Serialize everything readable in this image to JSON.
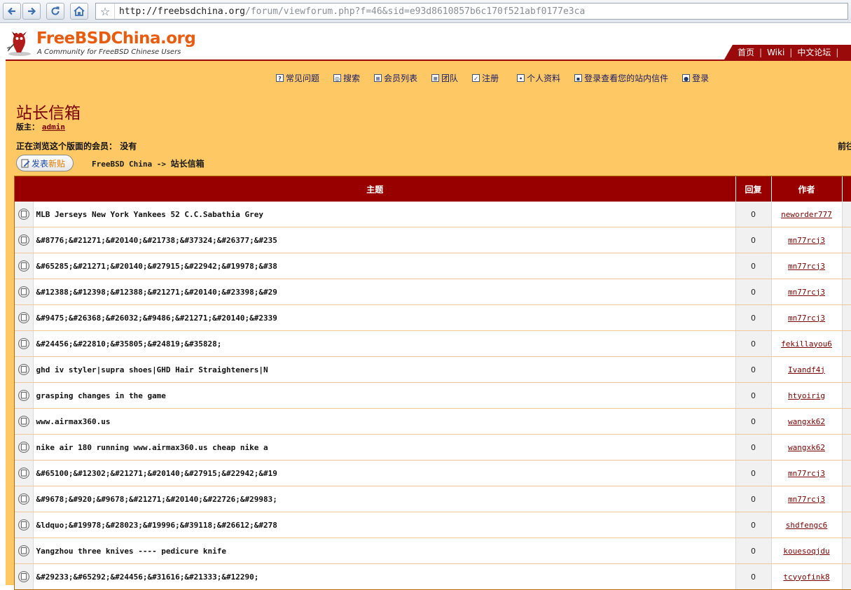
{
  "browser": {
    "url_host": "http://freebsdchina.org",
    "url_path": "/forum/viewforum.php?f=46&sid=e93d8610857b6c170f521abf0177e3ca"
  },
  "site": {
    "logo_title": "FreeBSDChina.org",
    "logo_subtitle": "A Community for FreeBSD Chinese Users",
    "top_links": [
      "首页",
      "Wiki",
      "中文论坛"
    ]
  },
  "menu": [
    {
      "icon": "faq-icon",
      "label": "常见问题"
    },
    {
      "icon": "search-icon",
      "label": "搜索"
    },
    {
      "icon": "memberlist-icon",
      "label": "会员列表"
    },
    {
      "icon": "group-icon",
      "label": "团队"
    },
    {
      "icon": "register-icon",
      "label": "注册"
    },
    {
      "icon": "profile-icon",
      "label": "个人资料"
    },
    {
      "icon": "messages-icon",
      "label": "登录查看您的站内信件"
    },
    {
      "icon": "login-icon",
      "label": "登录"
    }
  ],
  "forum": {
    "title": "站长信箱",
    "moderator_label": "版主：",
    "moderator_name": "admin",
    "viewing_label": "正在浏览这个版面的会员：",
    "viewing_value": "没有",
    "right_edge_text": "前往",
    "post_button_a": "发表",
    "post_button_b": "新贴",
    "breadcrumb_home": "FreeBSD China",
    "breadcrumb_arrow": "->",
    "breadcrumb_forum": "站长信箱"
  },
  "table": {
    "headers": {
      "topic": "主题",
      "replies": "回复",
      "author": "作者"
    },
    "rows": [
      {
        "topic": "MLB Jerseys New York Yankees 52 C.C.Sabathia Grey",
        "replies": "0",
        "author": "neworder777"
      },
      {
        "topic": "&#8776;&#21271;&#20140;&#21738;&#37324;&#26377;&#235",
        "replies": "0",
        "author": "mn77rcj3"
      },
      {
        "topic": "&#65285;&#21271;&#20140;&#27915;&#22942;&#19978;&#38",
        "replies": "0",
        "author": "mn77rcj3"
      },
      {
        "topic": "&#12388;&#12398;&#12388;&#21271;&#20140;&#23398;&#29",
        "replies": "0",
        "author": "mn77rcj3"
      },
      {
        "topic": "&#9475;&#26368;&#26032;&#9486;&#21271;&#20140;&#2339",
        "replies": "0",
        "author": "mn77rcj3"
      },
      {
        "topic": "&#24456;&#22810;&#35805;&#24819;&#35828;",
        "replies": "0",
        "author": "fekillayou6"
      },
      {
        "topic": "ghd iv styler|supra shoes|GHD Hair Straighteners|N",
        "replies": "0",
        "author": "Ivandf4j"
      },
      {
        "topic": "grasping changes in the game",
        "replies": "0",
        "author": "htyoirig"
      },
      {
        "topic": "www.airmax360.us",
        "replies": "0",
        "author": "wangxk62"
      },
      {
        "topic": "nike air 180 running www.airmax360.us cheap nike a",
        "replies": "0",
        "author": "wangxk62"
      },
      {
        "topic": "&#65100;&#12302;&#21271;&#20140;&#27915;&#22942;&#19",
        "replies": "0",
        "author": "mn77rcj3"
      },
      {
        "topic": "&#9678;&#920;&#9678;&#21271;&#20140;&#22726;&#29983;",
        "replies": "0",
        "author": "mn77rcj3"
      },
      {
        "topic": "&ldquo;&#19978;&#28023;&#19996;&#39118;&#26612;&#278",
        "replies": "0",
        "author": "shdfengc6"
      },
      {
        "topic": "Yangzhou three knives ---- pedicure knife",
        "replies": "0",
        "author": "kouesoqjdu"
      },
      {
        "topic": "&#29233;&#65292;&#24456;&#31616;&#21333;&#12290;",
        "replies": "0",
        "author": "tcyyofink8"
      }
    ]
  }
}
